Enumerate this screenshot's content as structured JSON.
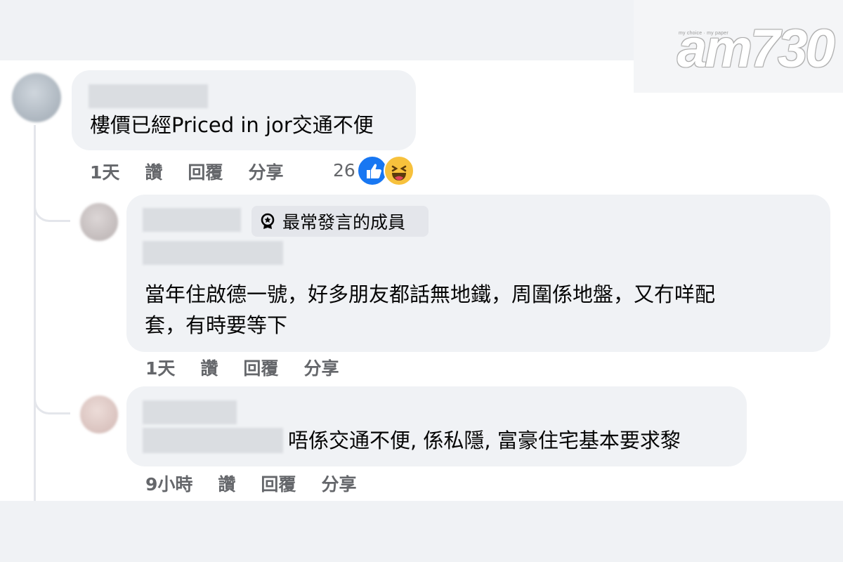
{
  "logo": {
    "tagline": "my choice · my paper",
    "wordmark": "am730"
  },
  "comments": [
    {
      "text": "樓價已經Priced in jor交通不便",
      "time": "1天",
      "like_label": "讚",
      "reply_label": "回覆",
      "share_label": "分享",
      "reaction_count": "26",
      "reactions": [
        "like-icon",
        "haha-icon"
      ]
    },
    {
      "badge_icon": "award-icon",
      "badge_label": "最常發言的成員",
      "text_line1": "當年住啟德一號，好多朋友都話無地鐵，周圍係地盤，又冇咩配",
      "text_line2": "套，有時要等下",
      "time": "1天",
      "like_label": "讚",
      "reply_label": "回覆",
      "share_label": "分享"
    },
    {
      "text": "唔係交通不便, 係私隱, 富豪住宅基本要求黎",
      "time": "9小時",
      "like_label": "讚",
      "reply_label": "回覆",
      "share_label": "分享"
    }
  ],
  "colors": {
    "bubble": "#f0f2f5",
    "action_text": "#65676b",
    "like_blue": "#1877f2",
    "haha_yellow": "#f7c13c"
  }
}
